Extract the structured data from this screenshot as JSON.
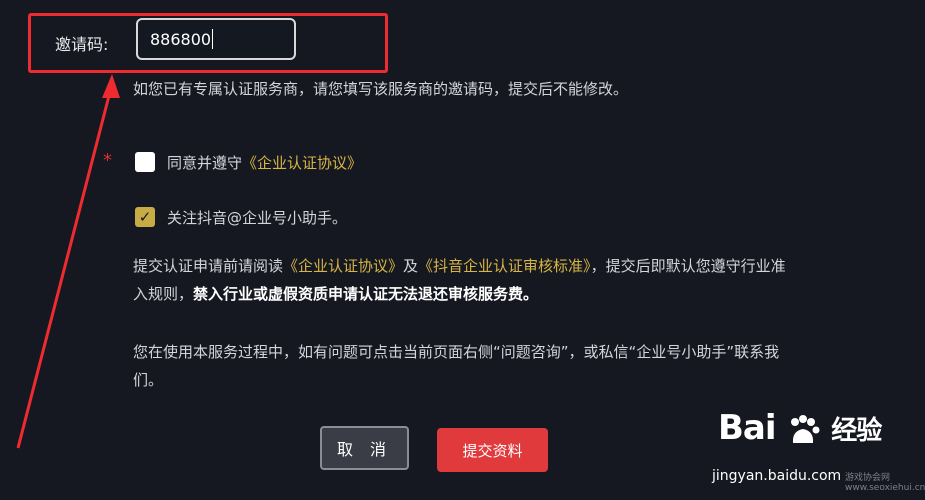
{
  "form": {
    "invite_label": "邀请码:",
    "invite_value": "886800",
    "invite_hint": "如您已有专属认证服务商，请您填写该服务商的邀请码，提交后不能修改。",
    "required_mark": "*",
    "agree_prefix": "同意并遵守",
    "agree_link": "《企业认证协议》",
    "follow_label": "关注抖音@企业号小助手。",
    "checkmark": "✓"
  },
  "notice": {
    "p1_a": "提交认证申请前请阅读",
    "p1_link1": "《企业认证协议》",
    "p1_b": "及",
    "p1_link2": "《抖音企业认证审核标准》",
    "p1_c": "，提交后即默认您遵守行业准入规则，",
    "p1_bold": "禁入行业或虚假资质申请认证无法退还审核服务费。",
    "p2": "您在使用本服务过程中，如有问题可点击当前页面右侧“问题咨询”，或私信“企业号小助手”联系我们。"
  },
  "buttons": {
    "cancel": "取 消",
    "submit": "提交资料"
  },
  "watermark": {
    "brand": "Bai",
    "brand_du": "du",
    "brand_suffix": "经验",
    "url": "jingyan.baidu.com",
    "small": "游戏协会网 www.seoxiehui.cn"
  },
  "colors": {
    "background": "#151820",
    "accent_gold": "#d6b545",
    "submit_red": "#e03a3c",
    "annotation_red": "#ee2b2f"
  },
  "icons": {
    "paw": "baidu-paw-icon",
    "arrow": "red-arrow-annotation"
  }
}
